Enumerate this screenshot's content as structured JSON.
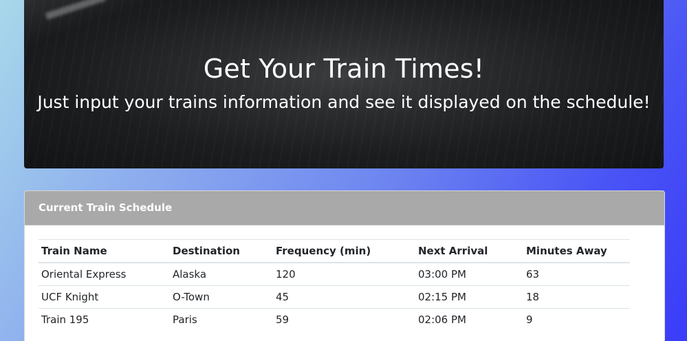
{
  "hero": {
    "title": "Get Your Train Times!",
    "subtitle": "Just input your trains information and see it displayed on the schedule!"
  },
  "schedule": {
    "heading": "Current Train Schedule",
    "columns": [
      "Train Name",
      "Destination",
      "Frequency (min)",
      "Next Arrival",
      "Minutes Away"
    ],
    "rows": [
      [
        "Oriental Express",
        "Alaska",
        "120",
        "03:00 PM",
        "63"
      ],
      [
        "UCF Knight",
        "O-Town",
        "45",
        "02:15 PM",
        "18"
      ],
      [
        "Train 195",
        "Paris",
        "59",
        "02:06 PM",
        "9"
      ]
    ]
  },
  "colors": {
    "card_header": "#a9a9a9",
    "background_start": "#a8d8ea",
    "background_end": "#3a3cf8",
    "hero_bg": "#1c1d1f"
  }
}
